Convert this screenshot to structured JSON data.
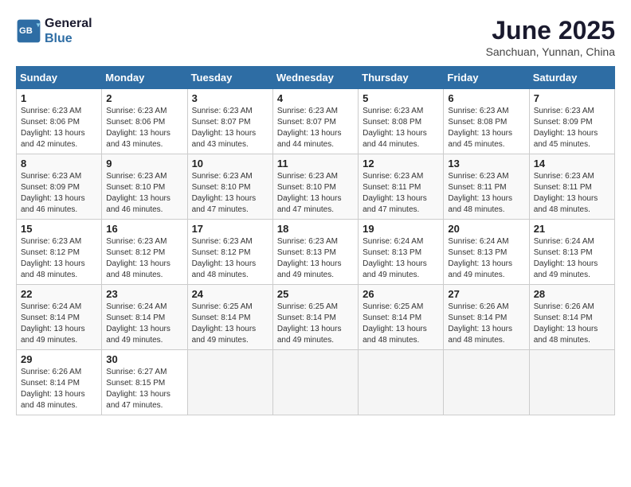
{
  "header": {
    "logo_line1": "General",
    "logo_line2": "Blue",
    "title": "June 2025",
    "subtitle": "Sanchuan, Yunnan, China"
  },
  "columns": [
    "Sunday",
    "Monday",
    "Tuesday",
    "Wednesday",
    "Thursday",
    "Friday",
    "Saturday"
  ],
  "weeks": [
    [
      {
        "day": 1,
        "sunrise": "6:23 AM",
        "sunset": "8:06 PM",
        "daylight": "13 hours and 42 minutes."
      },
      {
        "day": 2,
        "sunrise": "6:23 AM",
        "sunset": "8:06 PM",
        "daylight": "13 hours and 43 minutes."
      },
      {
        "day": 3,
        "sunrise": "6:23 AM",
        "sunset": "8:07 PM",
        "daylight": "13 hours and 43 minutes."
      },
      {
        "day": 4,
        "sunrise": "6:23 AM",
        "sunset": "8:07 PM",
        "daylight": "13 hours and 44 minutes."
      },
      {
        "day": 5,
        "sunrise": "6:23 AM",
        "sunset": "8:08 PM",
        "daylight": "13 hours and 44 minutes."
      },
      {
        "day": 6,
        "sunrise": "6:23 AM",
        "sunset": "8:08 PM",
        "daylight": "13 hours and 45 minutes."
      },
      {
        "day": 7,
        "sunrise": "6:23 AM",
        "sunset": "8:09 PM",
        "daylight": "13 hours and 45 minutes."
      }
    ],
    [
      {
        "day": 8,
        "sunrise": "6:23 AM",
        "sunset": "8:09 PM",
        "daylight": "13 hours and 46 minutes."
      },
      {
        "day": 9,
        "sunrise": "6:23 AM",
        "sunset": "8:10 PM",
        "daylight": "13 hours and 46 minutes."
      },
      {
        "day": 10,
        "sunrise": "6:23 AM",
        "sunset": "8:10 PM",
        "daylight": "13 hours and 47 minutes."
      },
      {
        "day": 11,
        "sunrise": "6:23 AM",
        "sunset": "8:10 PM",
        "daylight": "13 hours and 47 minutes."
      },
      {
        "day": 12,
        "sunrise": "6:23 AM",
        "sunset": "8:11 PM",
        "daylight": "13 hours and 47 minutes."
      },
      {
        "day": 13,
        "sunrise": "6:23 AM",
        "sunset": "8:11 PM",
        "daylight": "13 hours and 48 minutes."
      },
      {
        "day": 14,
        "sunrise": "6:23 AM",
        "sunset": "8:11 PM",
        "daylight": "13 hours and 48 minutes."
      }
    ],
    [
      {
        "day": 15,
        "sunrise": "6:23 AM",
        "sunset": "8:12 PM",
        "daylight": "13 hours and 48 minutes."
      },
      {
        "day": 16,
        "sunrise": "6:23 AM",
        "sunset": "8:12 PM",
        "daylight": "13 hours and 48 minutes."
      },
      {
        "day": 17,
        "sunrise": "6:23 AM",
        "sunset": "8:12 PM",
        "daylight": "13 hours and 48 minutes."
      },
      {
        "day": 18,
        "sunrise": "6:23 AM",
        "sunset": "8:13 PM",
        "daylight": "13 hours and 49 minutes."
      },
      {
        "day": 19,
        "sunrise": "6:24 AM",
        "sunset": "8:13 PM",
        "daylight": "13 hours and 49 minutes."
      },
      {
        "day": 20,
        "sunrise": "6:24 AM",
        "sunset": "8:13 PM",
        "daylight": "13 hours and 49 minutes."
      },
      {
        "day": 21,
        "sunrise": "6:24 AM",
        "sunset": "8:13 PM",
        "daylight": "13 hours and 49 minutes."
      }
    ],
    [
      {
        "day": 22,
        "sunrise": "6:24 AM",
        "sunset": "8:14 PM",
        "daylight": "13 hours and 49 minutes."
      },
      {
        "day": 23,
        "sunrise": "6:24 AM",
        "sunset": "8:14 PM",
        "daylight": "13 hours and 49 minutes."
      },
      {
        "day": 24,
        "sunrise": "6:25 AM",
        "sunset": "8:14 PM",
        "daylight": "13 hours and 49 minutes."
      },
      {
        "day": 25,
        "sunrise": "6:25 AM",
        "sunset": "8:14 PM",
        "daylight": "13 hours and 49 minutes."
      },
      {
        "day": 26,
        "sunrise": "6:25 AM",
        "sunset": "8:14 PM",
        "daylight": "13 hours and 48 minutes."
      },
      {
        "day": 27,
        "sunrise": "6:26 AM",
        "sunset": "8:14 PM",
        "daylight": "13 hours and 48 minutes."
      },
      {
        "day": 28,
        "sunrise": "6:26 AM",
        "sunset": "8:14 PM",
        "daylight": "13 hours and 48 minutes."
      }
    ],
    [
      {
        "day": 29,
        "sunrise": "6:26 AM",
        "sunset": "8:14 PM",
        "daylight": "13 hours and 48 minutes."
      },
      {
        "day": 30,
        "sunrise": "6:27 AM",
        "sunset": "8:15 PM",
        "daylight": "13 hours and 47 minutes."
      },
      null,
      null,
      null,
      null,
      null
    ]
  ]
}
